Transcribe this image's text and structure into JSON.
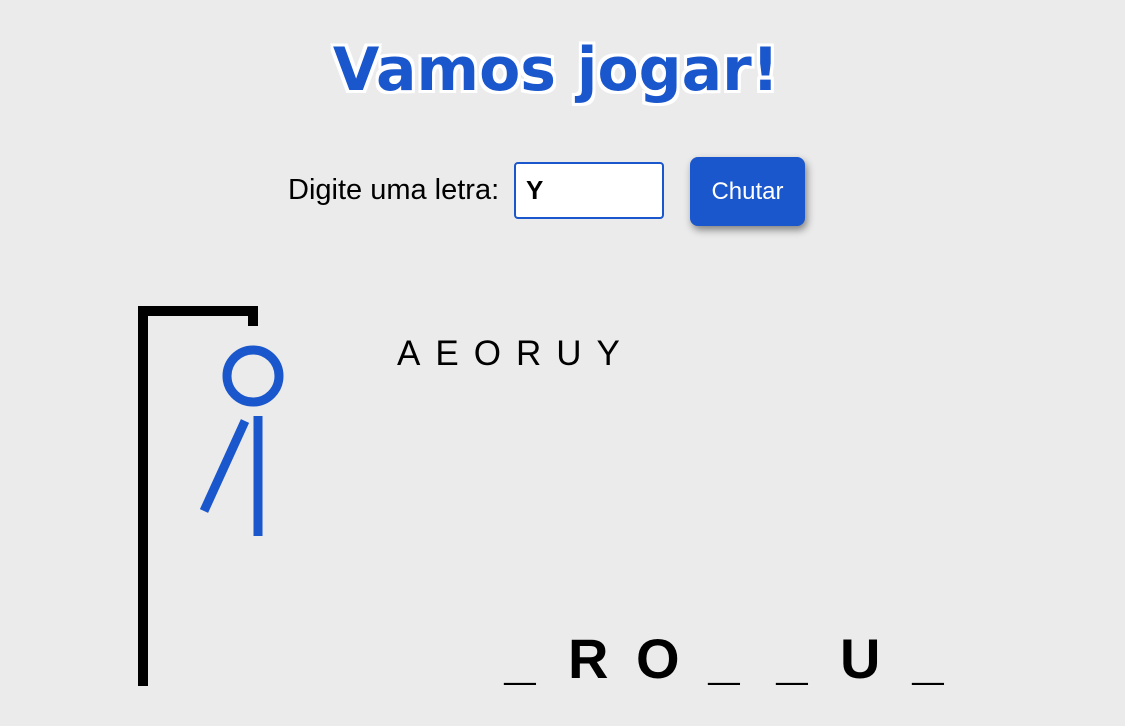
{
  "title": "Vamos jogar!",
  "form": {
    "label": "Digite uma letra:",
    "input_value": "Y",
    "button_label": "Chutar"
  },
  "used_letters": [
    "A",
    "E",
    "O",
    "R",
    "U",
    "Y"
  ],
  "word_slots": [
    "_",
    "R",
    "O",
    "_",
    "_",
    "U",
    "_"
  ],
  "hangman": {
    "parts_shown": [
      "head",
      "body",
      "left-arm"
    ],
    "gallows_color": "#000000",
    "figure_color": "#1a56cc"
  },
  "colors": {
    "accent": "#1a56cc",
    "background": "#ebebeb"
  }
}
